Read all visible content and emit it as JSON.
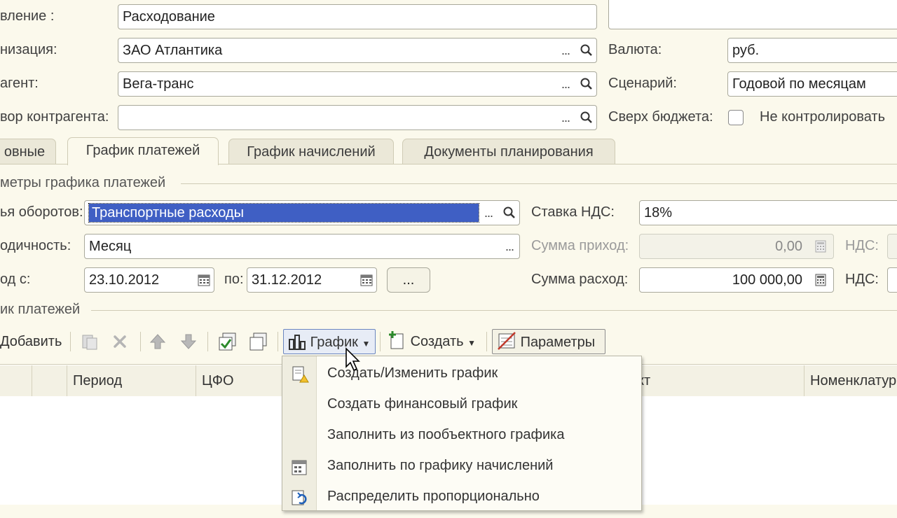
{
  "header": {
    "purpose_label": "вление :",
    "purpose_value": "Расходование",
    "org_label": "низация:",
    "org_value": "ЗАО Атлантика",
    "counterparty_label": "агент:",
    "counterparty_value": "Вега-транс",
    "contract_label": "вор контрагента:",
    "contract_value": "",
    "currency_label": "Валюта:",
    "currency_value": "руб.",
    "scenario_label": "Сценарий:",
    "scenario_value": "Годовой по месяцам",
    "over_budget_label": "Сверх бюджета:",
    "no_control_label": "Не контролировать",
    "dots": "...",
    "open_dots": "..."
  },
  "tabs": [
    {
      "label": "овные"
    },
    {
      "label": "График платежей"
    },
    {
      "label": "График начислений"
    },
    {
      "label": "Документы планирования"
    }
  ],
  "params": {
    "group_title": "метры графика платежей",
    "item_label": "ья оборотов:",
    "item_value": "Транспортные расходы",
    "period_label": "одичность:",
    "period_value": "Месяц",
    "from_label": "од с:",
    "from_value": "23.10.2012",
    "to_label": "по:",
    "to_value": "31.12.2012",
    "vat_rate_label": "Ставка НДС:",
    "vat_rate_value": "18%",
    "income_label": "Сумма приход:",
    "income_value": "0,00",
    "expense_label": "Сумма расход:",
    "expense_value": "100 000,00",
    "vat_label": "НДС:"
  },
  "schedule": {
    "group_title": "ик платежей",
    "toolbar": {
      "add": "Добавить",
      "chart": "График",
      "create": "Создать",
      "params": "Параметры"
    },
    "columns": [
      "Период",
      "ЦФО",
      "кт",
      "Номенклатур"
    ]
  },
  "menu": {
    "items": [
      {
        "label": "Создать/Изменить график",
        "icon": "edit-chart-icon"
      },
      {
        "label": "Создать финансовый график",
        "icon": ""
      },
      {
        "label": "Заполнить из пообъектного графика",
        "icon": ""
      },
      {
        "label": "Заполнить по графику начислений",
        "icon": "fill-by-accruals-icon"
      },
      {
        "label": "Распределить пропорционально",
        "icon": "distribute-icon"
      }
    ]
  },
  "colors": {
    "background": "#fbf9ec",
    "selection": "#3f5fc4"
  }
}
